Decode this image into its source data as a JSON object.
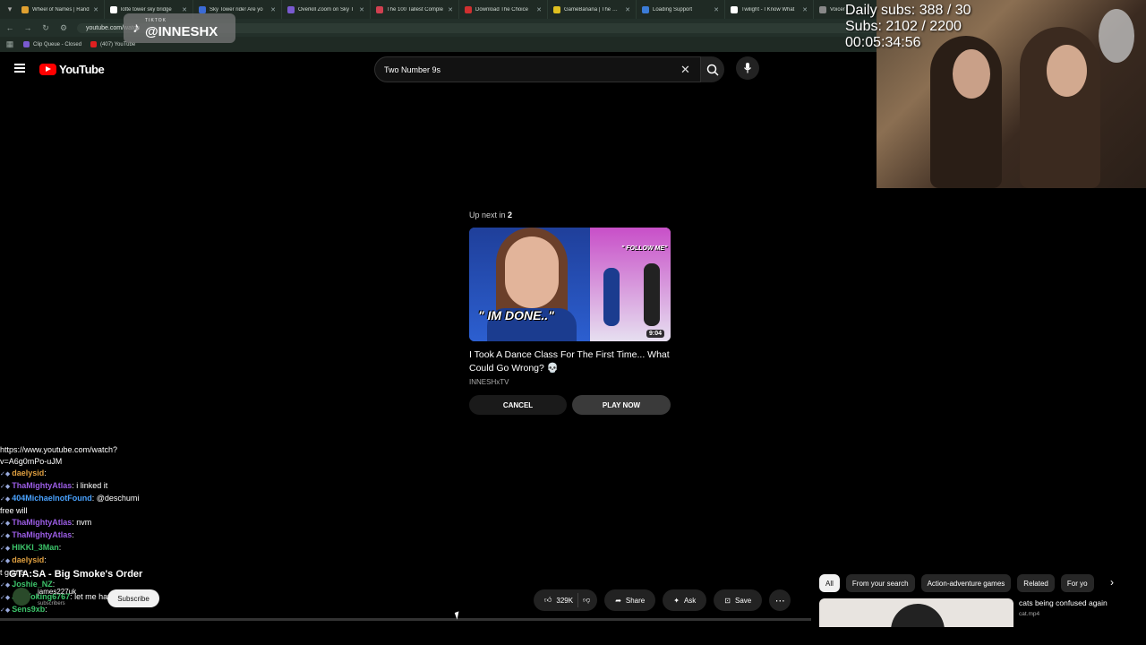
{
  "browser": {
    "tabs": [
      {
        "label": "Wheel of Names | Rand",
        "color": "#e0a030"
      },
      {
        "label": "lotte tower sky bridge",
        "color": "#ffffff"
      },
      {
        "label": "Sky Tower ride! Are yo",
        "color": "#3b6bd6"
      },
      {
        "label": "Overkill Zoom on Sky T",
        "color": "#7a5ad0"
      },
      {
        "label": "The 100 Tallest Comple",
        "color": "#d04050"
      },
      {
        "label": "Download The Choice",
        "color": "#d03030"
      },
      {
        "label": "GameBanana | The Gam",
        "color": "#e0c020"
      },
      {
        "label": "Loading Support",
        "color": "#3b7bd6"
      },
      {
        "label": "Twilight - I Know What",
        "color": "#ffffff"
      },
      {
        "label": "Voicer",
        "color": "#888888"
      }
    ],
    "url": "youtube.com/watch",
    "bookmarks": [
      {
        "label": "Clip Queue - Closed",
        "color": "#7a5ad0"
      },
      {
        "label": "(407) YouTube",
        "color": "#e02020"
      }
    ]
  },
  "tiktok": {
    "small": "TIKTOK",
    "handle": "@INNESHX"
  },
  "stream": {
    "daily_subs": "Daily subs: 388 / 30",
    "subs": "Subs: 2102 / 2200",
    "timer": "00:05:34:56"
  },
  "youtube": {
    "logo_text": "YouTube",
    "search_value": "Two Number 9s"
  },
  "up_next": {
    "label": "Up next in ",
    "count": "2",
    "duration": "9:04",
    "thumb_text_left": "\" IM DONE..\"",
    "thumb_text_right": "\" FOLLOW ME\"",
    "title": "I Took A Dance Class For The First Time... What Could Go Wrong? 💀",
    "channel": "INNESHxTV",
    "cancel_label": "CANCEL",
    "play_label": "PLAY NOW"
  },
  "chat": [
    {
      "user": "",
      "text": "https://www.youtube.com/watch?",
      "color": "#ffffff"
    },
    {
      "user": "",
      "text": "v=A6g0mPo-uJM",
      "color": "#ffffff"
    },
    {
      "user": "daelysid",
      "text": ":",
      "color": "#e0a040"
    },
    {
      "user": "ThaMightyAtlas",
      "text": ": i linked it",
      "color": "#9b5de5"
    },
    {
      "user": "404MichaelnotFound",
      "text": ": @deschumi",
      "color": "#4aa3ff"
    },
    {
      "user": "",
      "text": "free will",
      "color": "#ffffff"
    },
    {
      "user": "ThaMightyAtlas",
      "text": ": nvm",
      "color": "#9b5de5"
    },
    {
      "user": "ThaMightyAtlas",
      "text": ":",
      "color": "#9b5de5"
    },
    {
      "user": "HIKKI_3Man",
      "text": ":",
      "color": "#3cc46a"
    },
    {
      "user": "daelysid",
      "text": ":",
      "color": "#e0a040"
    },
    {
      "user": "",
      "text": "t game",
      "color": "#ffffff"
    },
    {
      "user": "Joshie_NZ",
      "text": ":",
      "color": "#3cc46a"
    },
    {
      "user": "JusYoking6767",
      "text": ": let me have no",
      "color": "#3cc46a"
    },
    {
      "user": "Sens9xb",
      "text": ":",
      "color": "#3cc46a"
    }
  ],
  "video_info": {
    "game_title": "GTA:SA - Big Smoke's Order",
    "channel": "james227uk",
    "subs": "subscribers",
    "subscribe_label": "Subscribe",
    "likes": "329K",
    "share_label": "Share",
    "ask_label": "Ask",
    "save_label": "Save"
  },
  "chips": [
    "All",
    "From your search",
    "Action-adventure games",
    "Related",
    "For yo"
  ],
  "recommended": {
    "title": "cats being confused again",
    "sub": "cat.mp4"
  }
}
